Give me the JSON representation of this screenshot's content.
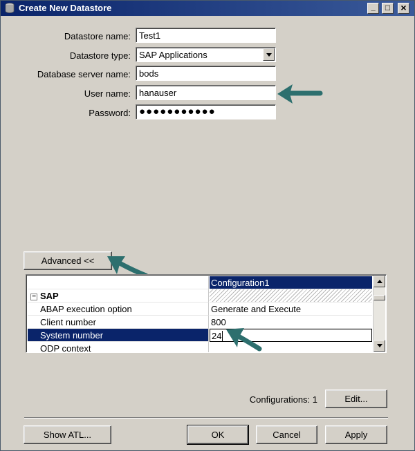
{
  "window": {
    "title": "Create New Datastore",
    "controls": {
      "minimize": "_",
      "maximize": "□",
      "close": "×"
    }
  },
  "form": {
    "datastore_name": {
      "label": "Datastore name:",
      "value": "Test1"
    },
    "datastore_type": {
      "label": "Datastore type:",
      "value": "SAP Applications"
    },
    "db_server": {
      "label": "Database server name:",
      "value": "bods"
    },
    "user_name": {
      "label": "User name:",
      "value": "hanauser"
    },
    "password": {
      "label": "Password:",
      "value": "●●●●●●●●●●●"
    }
  },
  "advanced_button": "Advanced <<",
  "config_grid": {
    "column_header": "Configuration1",
    "group": {
      "toggle": "−",
      "name": "SAP"
    },
    "rows": [
      {
        "name": "ABAP execution option",
        "value": "Generate and Execute"
      },
      {
        "name": "Client number",
        "value": "800"
      },
      {
        "name": "System number",
        "value": "24"
      },
      {
        "name": "ODP context",
        "value": ""
      }
    ]
  },
  "configurations": {
    "label": "Configurations: 1",
    "edit_button": "Edit..."
  },
  "footer": {
    "show_atl": "Show ATL...",
    "ok": "OK",
    "cancel": "Cancel",
    "apply": "Apply"
  },
  "colors": {
    "title_bar": "#0a246a",
    "selection": "#0a246a",
    "annotation_arrow": "#2d6f6e",
    "dialog_bg": "#d4d0c8"
  },
  "icons": [
    "datastore-icon",
    "minimize-icon",
    "maximize-icon",
    "close-icon",
    "dropdown-arrow-icon",
    "scroll-up-icon",
    "scroll-down-icon"
  ]
}
